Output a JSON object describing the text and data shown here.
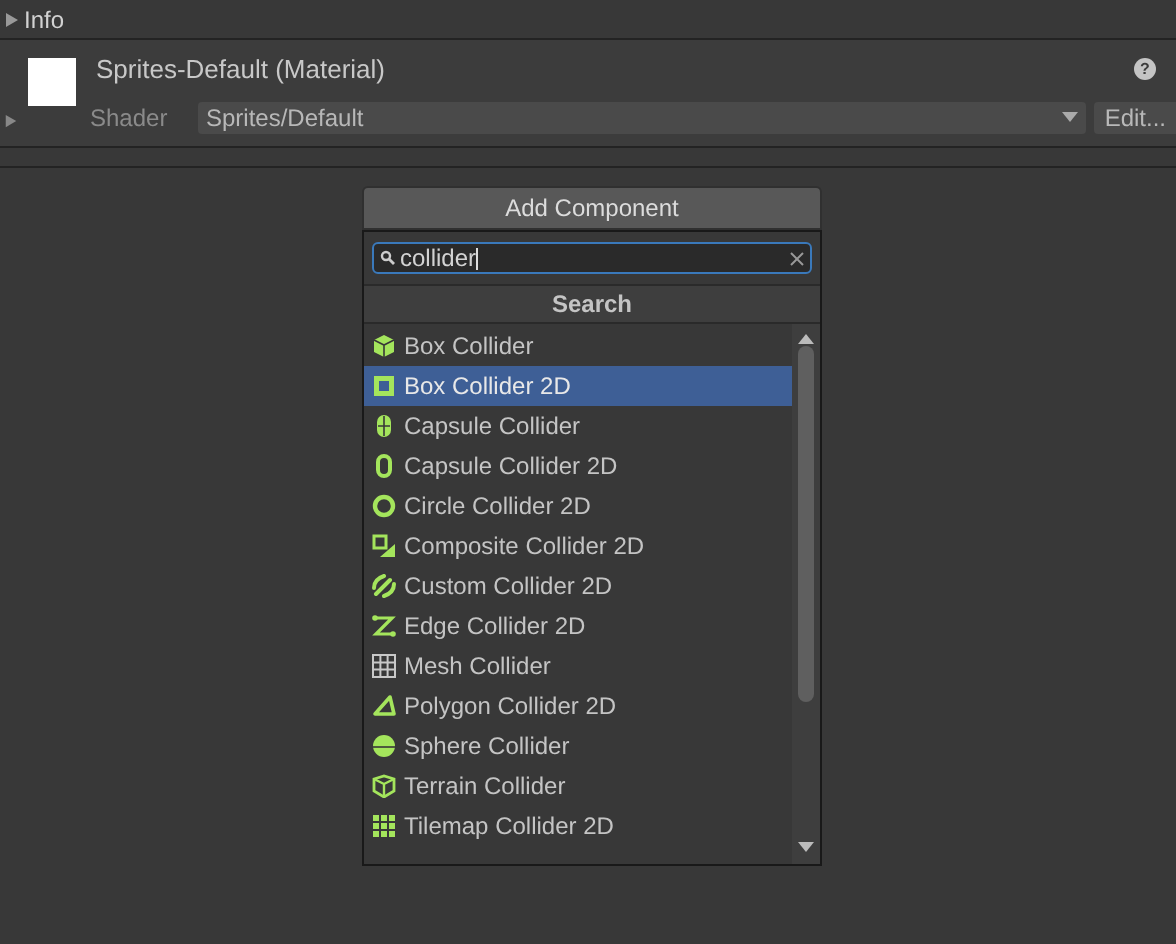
{
  "info": {
    "label": "Info",
    "expanded": false
  },
  "material": {
    "title": "Sprites-Default (Material)",
    "shader_label": "Shader",
    "shader_value": "Sprites/Default",
    "edit_button": "Edit...",
    "help": "?"
  },
  "popup": {
    "title": "Add Component",
    "search": {
      "value": "collider"
    },
    "section": "Search",
    "items": [
      {
        "label": "Box Collider",
        "kind": "box",
        "selected": false
      },
      {
        "label": "Box Collider 2D",
        "kind": "box2d",
        "selected": true
      },
      {
        "label": "Capsule Collider",
        "kind": "capsule",
        "selected": false
      },
      {
        "label": "Capsule Collider 2D",
        "kind": "capsule2d",
        "selected": false
      },
      {
        "label": "Circle Collider 2D",
        "kind": "circle",
        "selected": false
      },
      {
        "label": "Composite Collider 2D",
        "kind": "composite",
        "selected": false
      },
      {
        "label": "Custom Collider 2D",
        "kind": "custom",
        "selected": false
      },
      {
        "label": "Edge Collider 2D",
        "kind": "edge",
        "selected": false
      },
      {
        "label": "Mesh Collider",
        "kind": "mesh",
        "selected": false
      },
      {
        "label": "Polygon Collider 2D",
        "kind": "polygon",
        "selected": false
      },
      {
        "label": "Sphere Collider",
        "kind": "sphere",
        "selected": false
      },
      {
        "label": "Terrain Collider",
        "kind": "terrain",
        "selected": false
      },
      {
        "label": "Tilemap Collider 2D",
        "kind": "tilemap",
        "selected": false
      }
    ]
  }
}
